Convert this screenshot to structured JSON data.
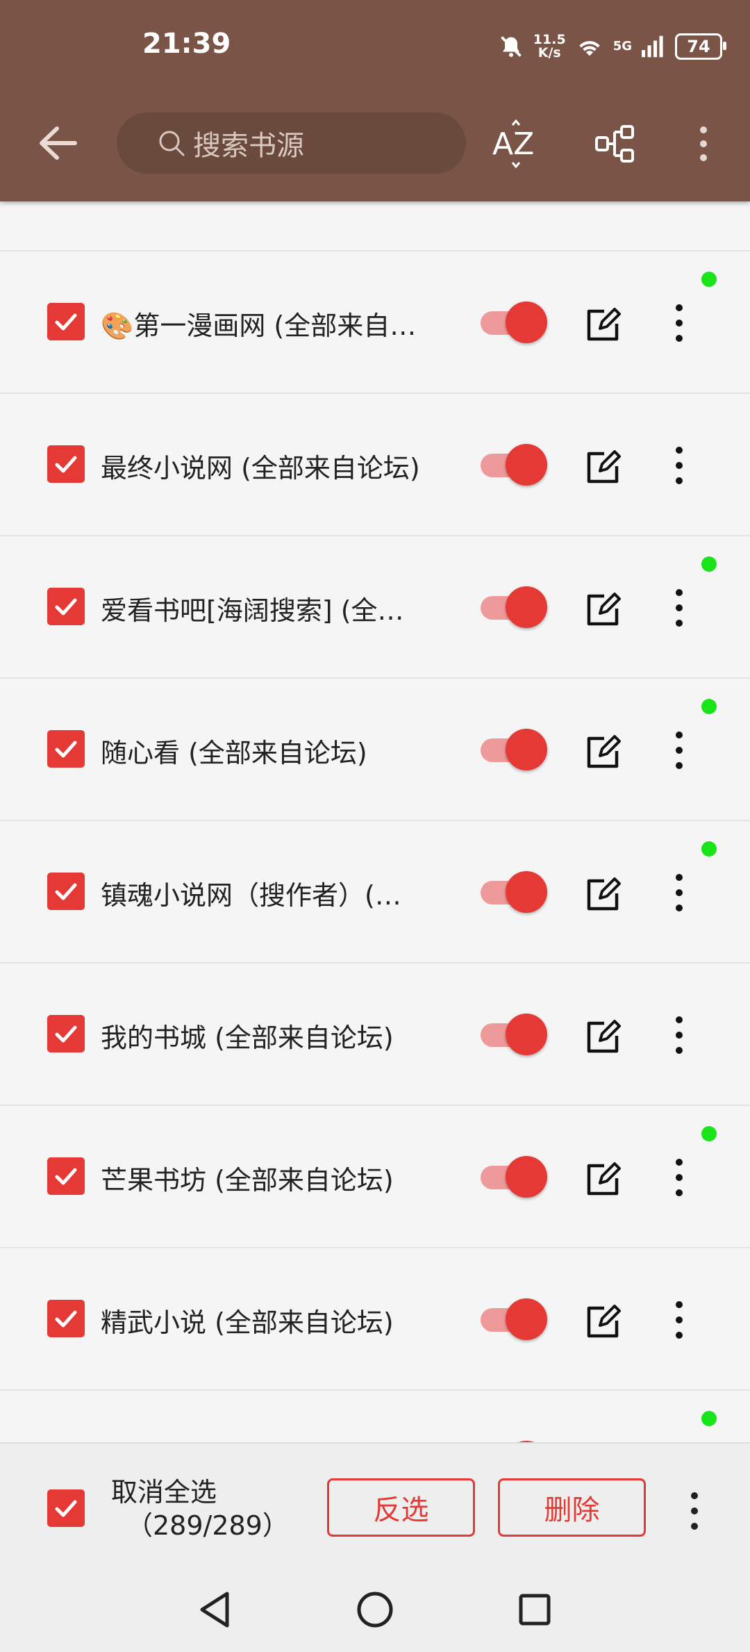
{
  "status_bar": {
    "time": "21:39",
    "net_speed_value": "11.5",
    "net_speed_unit": "K/s",
    "network": "5G",
    "battery": "74"
  },
  "toolbar": {
    "search_placeholder": "搜索书源",
    "sort_icon_label": "AZ"
  },
  "rows": [
    {
      "name": "🎨第一漫画网 (全部来自…",
      "enabled": true,
      "checked": true,
      "indicator": true
    },
    {
      "name": "最终小说网 (全部来自论坛)",
      "enabled": true,
      "checked": true,
      "indicator": false
    },
    {
      "name": "爱看书吧[海阔搜索] (全…",
      "enabled": true,
      "checked": true,
      "indicator": true
    },
    {
      "name": "随心看 (全部来自论坛)",
      "enabled": true,
      "checked": true,
      "indicator": true
    },
    {
      "name": "镇魂小说网（搜作者）(…",
      "enabled": true,
      "checked": true,
      "indicator": true
    },
    {
      "name": "我的书城 (全部来自论坛)",
      "enabled": true,
      "checked": true,
      "indicator": false
    },
    {
      "name": "芒果书坊 (全部来自论坛)",
      "enabled": true,
      "checked": true,
      "indicator": true
    },
    {
      "name": "精武小说 (全部来自论坛)",
      "enabled": true,
      "checked": true,
      "indicator": false
    }
  ],
  "bottom_bar": {
    "select_label": "取消全选",
    "count": "（289/289）",
    "invert_button": "反选",
    "delete_button": "删除"
  },
  "colors": {
    "appbar": "#7a5446",
    "accent": "#e53935",
    "track": "#ee9a9a",
    "indicator": "#19e319"
  }
}
